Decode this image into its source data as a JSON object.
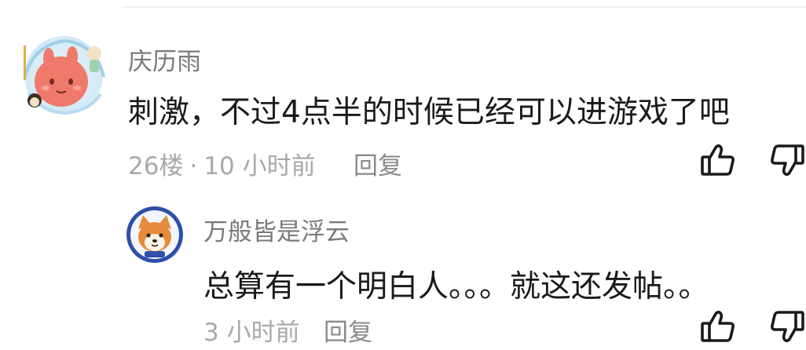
{
  "comment": {
    "username": "庆历雨",
    "content": "刺激，不过4点半的时候已经可以进游戏了吧",
    "floor": "26楼",
    "separator": "·",
    "time": "10 小时前",
    "reply_label": "回复",
    "like_icon": "thumbs-up-icon",
    "dislike_icon": "thumbs-down-icon"
  },
  "reply": {
    "username": "万般皆是浮云",
    "content": "总算有一个明白人。。。就这还发帖。。",
    "time": "3 小时前",
    "reply_label": "回复",
    "like_icon": "thumbs-up-icon",
    "dislike_icon": "thumbs-down-icon"
  },
  "colors": {
    "username": "#7a7a7a",
    "content": "#1a1a1a",
    "meta": "#a9a9a9",
    "icon_stroke": "#1a1a1a"
  }
}
